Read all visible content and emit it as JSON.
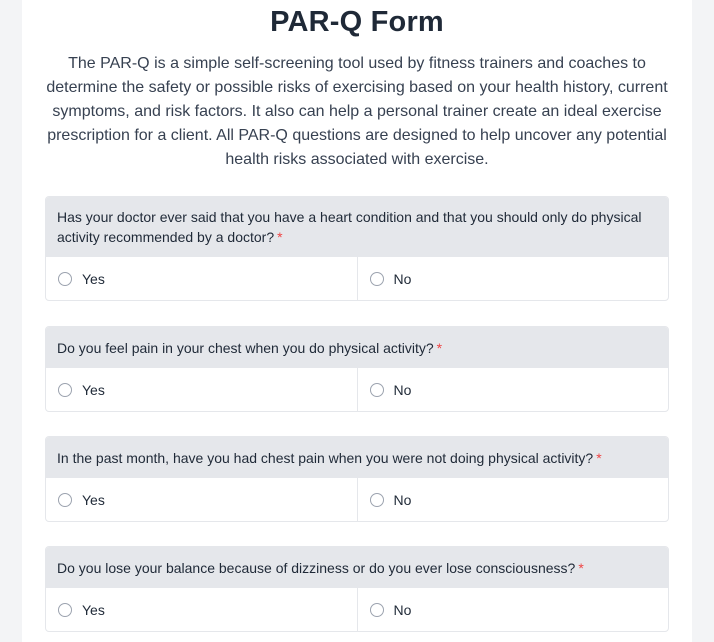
{
  "form": {
    "title": "PAR-Q Form",
    "description": "The PAR-Q is a simple self-screening tool used by fitness trainers and coaches to determine the safety or possible risks of exercising based on your health history, current symptoms, and risk factors. It also can help a personal trainer create an ideal exercise prescription for a client. All PAR-Q questions are designed to help uncover any potential health risks associated with exercise."
  },
  "required_marker": "*",
  "questions": [
    {
      "text": "Has your doctor ever said that you have a heart condition and that you should only do physical activity recommended by a doctor?",
      "options": [
        "Yes",
        "No"
      ]
    },
    {
      "text": "Do you feel pain in your chest when you do physical activity?",
      "options": [
        "Yes",
        "No"
      ]
    },
    {
      "text": "In the past month, have you had chest pain when you were not doing physical activity?",
      "options": [
        "Yes",
        "No"
      ]
    },
    {
      "text": "Do you lose your balance because of dizziness or do you ever lose consciousness?",
      "options": [
        "Yes",
        "No"
      ]
    }
  ],
  "colors": {
    "required": "#ef4444",
    "header_bg": "#e5e7eb"
  }
}
